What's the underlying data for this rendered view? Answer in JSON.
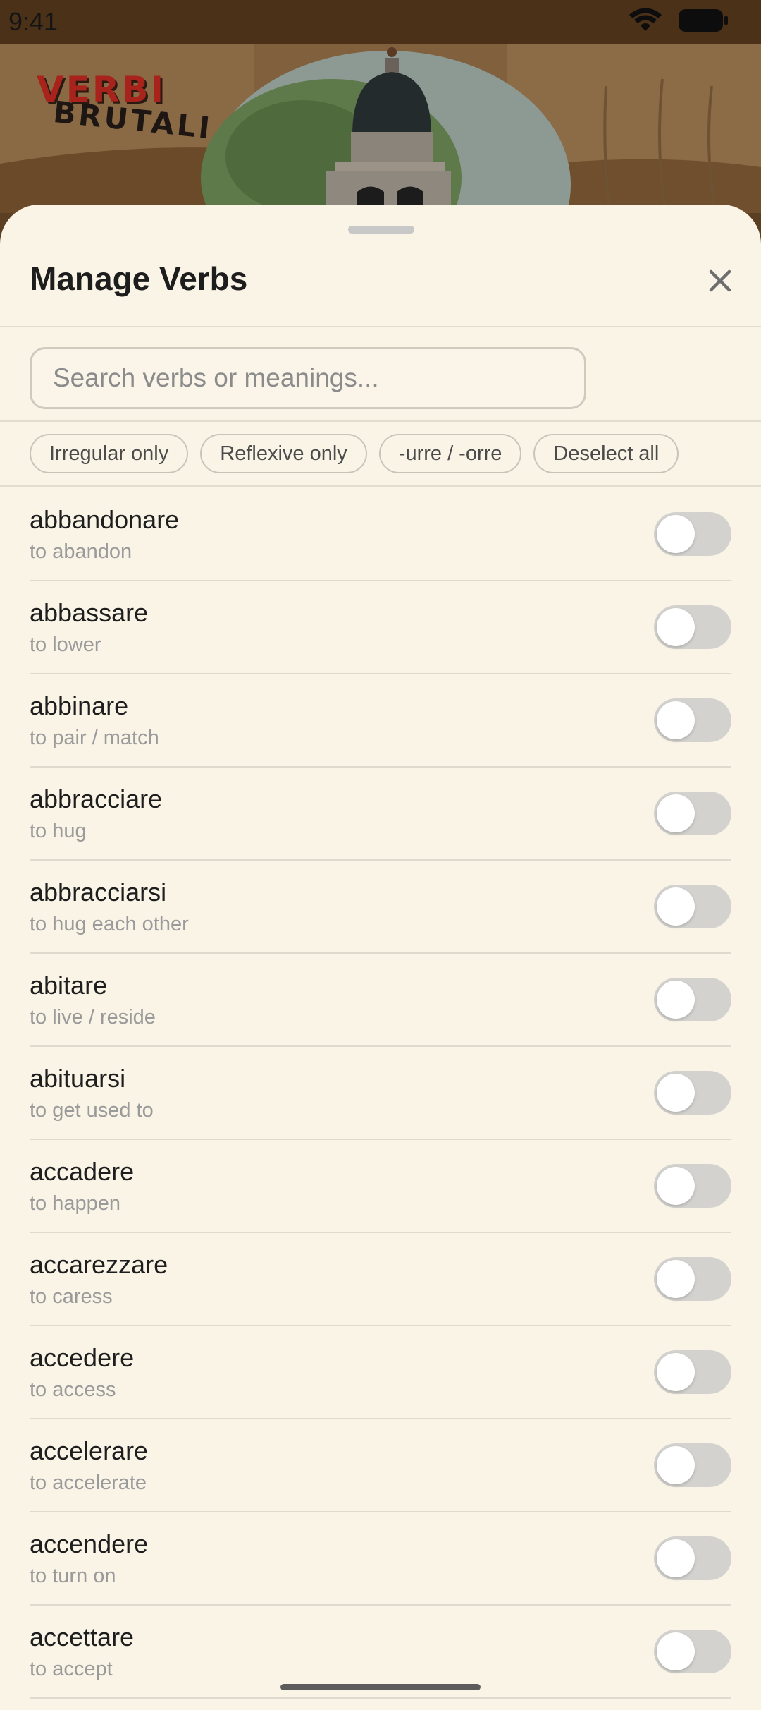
{
  "status_bar": {
    "time": "9:41",
    "icons": [
      "wifi-icon",
      "battery-icon"
    ]
  },
  "background": {
    "logo_text": [
      "VERBI",
      "BRUTALI"
    ]
  },
  "sheet": {
    "title": "Manage Verbs",
    "close_icon": "close-icon",
    "search": {
      "placeholder": "Search verbs or meanings...",
      "value": ""
    },
    "filters": [
      {
        "label": "Irregular only"
      },
      {
        "label": "Reflexive only"
      },
      {
        "label": "-urre / -orre"
      },
      {
        "label": "Deselect all"
      }
    ],
    "verbs": [
      {
        "name": "abbandonare",
        "meaning": "to abandon",
        "enabled": false
      },
      {
        "name": "abbassare",
        "meaning": "to lower",
        "enabled": false
      },
      {
        "name": "abbinare",
        "meaning": "to pair / match",
        "enabled": false
      },
      {
        "name": "abbracciare",
        "meaning": "to hug",
        "enabled": false
      },
      {
        "name": "abbracciarsi",
        "meaning": "to hug each other",
        "enabled": false
      },
      {
        "name": "abitare",
        "meaning": "to live / reside",
        "enabled": false
      },
      {
        "name": "abituarsi",
        "meaning": "to get used to",
        "enabled": false
      },
      {
        "name": "accadere",
        "meaning": "to happen",
        "enabled": false
      },
      {
        "name": "accarezzare",
        "meaning": "to caress",
        "enabled": false
      },
      {
        "name": "accedere",
        "meaning": "to access",
        "enabled": false
      },
      {
        "name": "accelerare",
        "meaning": "to accelerate",
        "enabled": false
      },
      {
        "name": "accendere",
        "meaning": "to turn on",
        "enabled": false
      },
      {
        "name": "accettare",
        "meaning": "to accept",
        "enabled": false
      }
    ]
  },
  "colors": {
    "sheet_background": "#faf4e7",
    "toggle_off": "#d3d2cf",
    "logo_red": "#a8231b"
  }
}
